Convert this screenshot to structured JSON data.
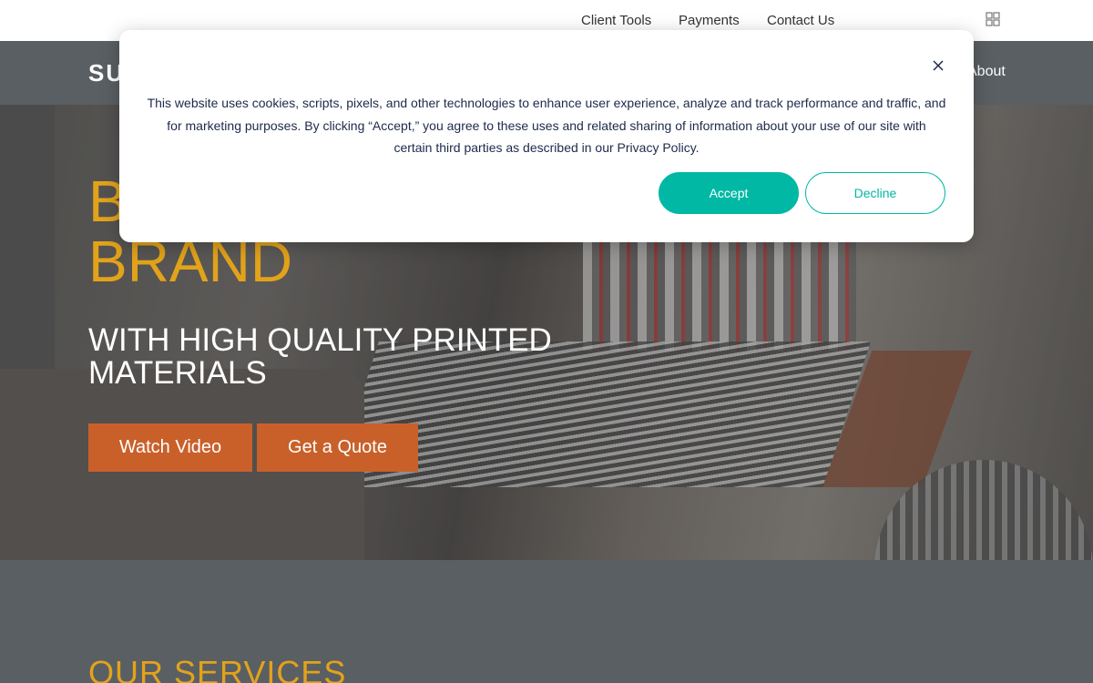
{
  "topbar": {
    "links": [
      "Client Tools",
      "Payments",
      "Contact Us"
    ],
    "apps_icon": "grid-icon"
  },
  "nav": {
    "logo_text": "SU",
    "about_label": "About"
  },
  "hero": {
    "headline_line1": "B",
    "headline_line2": "BRAND",
    "subheadline": "WITH HIGH QUALITY PRINTED MATERIALS",
    "watch_video_label": "Watch Video",
    "get_quote_label": "Get a Quote"
  },
  "services": {
    "heading": "OUR SERVICES"
  },
  "cookie_modal": {
    "text": "This website uses cookies, scripts, pixels, and other technologies to enhance user experience, analyze and track performance and traffic, and for marketing purposes. By clicking “Accept,” you agree to these uses and related sharing of information about your use of our site with certain third parties as described in our Privacy Policy.",
    "accept_label": "Accept",
    "decline_label": "Decline",
    "close_icon": "close-icon"
  },
  "colors": {
    "accent_gold": "#e2a31a",
    "cta_orange": "#c9602a",
    "teal": "#00b8a4",
    "nav_gray": "#5a5f63"
  }
}
